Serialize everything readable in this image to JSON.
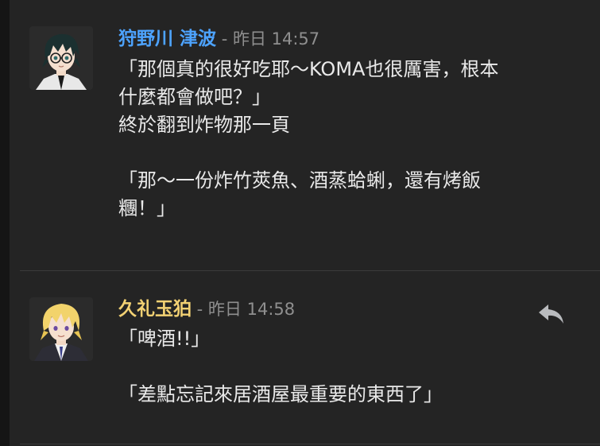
{
  "messages": [
    {
      "author": "狩野川 津波",
      "author_color": "#4da3ff",
      "meta": " - 昨日 14:57",
      "avatar_icon": "avatar-black-hair-glasses",
      "lines": [
        "「那個真的很好吃耶〜KOMA也很厲害，根本",
        "什麼都會做吧？」",
        "終於翻到炸物那一頁",
        "",
        "「那〜一份炸竹莢魚、酒蒸蛤蜊，還有烤飯",
        "糰！」"
      ]
    },
    {
      "author": "久礼玉狛",
      "author_color": "#f2d173",
      "meta": " - 昨日 14:58",
      "avatar_icon": "avatar-blond-hair",
      "reply_icon": "reply-icon",
      "lines": [
        "「啤酒!!」",
        "",
        "「差點忘記來居酒屋最重要的東西了」"
      ]
    }
  ]
}
